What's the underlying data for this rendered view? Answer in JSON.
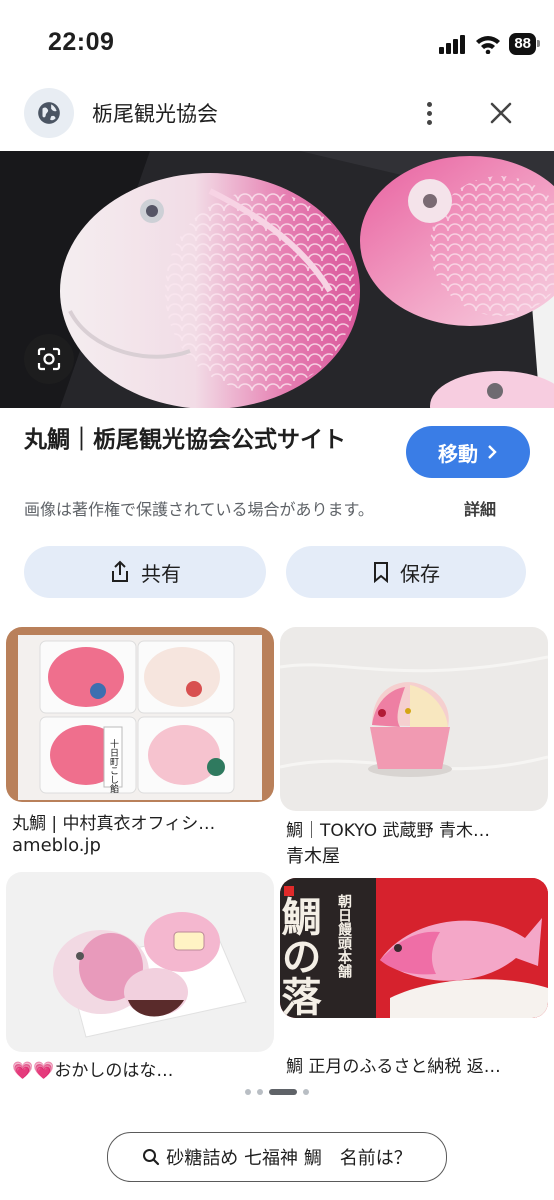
{
  "status_bar": {
    "time": "22:09",
    "battery": "88"
  },
  "url_bar": {
    "site_title": "栃尾観光協会"
  },
  "result": {
    "title": "丸鯛｜栃尾観光協会公式サイト",
    "visit_label": "移動",
    "copyright_notice": "画像は著作権で保護されている場合があります。",
    "details_label": "詳細"
  },
  "actions": {
    "share_label": "共有",
    "save_label": "保存"
  },
  "related": [
    {
      "caption": "丸鯛 | 中村真衣オフィシ…",
      "source": "ameblo.jp"
    },
    {
      "caption": "鯛｜TOKYO 武蔵野 青木…",
      "source": "青木屋"
    },
    {
      "caption": "💗💗おかしのはな…",
      "source": ""
    },
    {
      "caption": "鯛 正月のふるさと納税 返…",
      "source": ""
    }
  ],
  "thumb_text": {
    "t1_label": "十日町こし餡",
    "t4_big": "鯛の落雁",
    "t4_small": "朝日饅頭本舗"
  },
  "search_suggestion": "砂糖詰め 七福神 鯛　名前は？",
  "colors": {
    "accent": "#3a7de6",
    "chip_bg": "#e4ecf8",
    "pink": "#e46aa6"
  },
  "icons": [
    "globe-icon",
    "more-vert-icon",
    "close-icon",
    "lens-icon",
    "chevron-right-icon",
    "share-icon",
    "bookmark-icon",
    "search-icon"
  ]
}
